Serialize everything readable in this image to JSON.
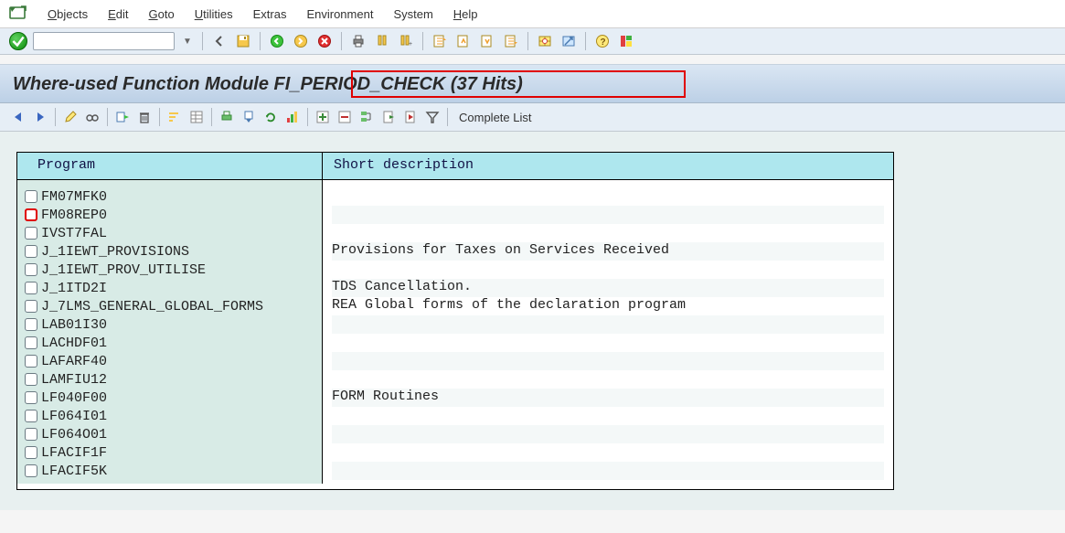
{
  "menu": {
    "items": [
      {
        "label": "Objects",
        "ul": "O"
      },
      {
        "label": "Edit",
        "ul": "E"
      },
      {
        "label": "Goto",
        "ul": "G"
      },
      {
        "label": "Utilities",
        "ul": "U"
      },
      {
        "label": "Extras",
        "ul": "E"
      },
      {
        "label": "Environment",
        "ul": "E"
      },
      {
        "label": "System",
        "ul": "S"
      },
      {
        "label": "Help",
        "ul": "H"
      }
    ]
  },
  "title": {
    "prefix": "Where-used Function Module ",
    "highlight": "FI_PERIOD_CHECK (37 Hits)"
  },
  "app_toolbar": {
    "complete_list": "Complete List"
  },
  "list": {
    "headers": {
      "program": "Program",
      "short_desc": "Short description"
    },
    "rows": [
      {
        "prog": "FM07MFK0",
        "desc": ""
      },
      {
        "prog": "FM08REP0",
        "desc": "",
        "red_cb": true
      },
      {
        "prog": "IVST7FAL",
        "desc": ""
      },
      {
        "prog": "J_1IEWT_PROVISIONS",
        "desc": "Provisions for Taxes on Services Received"
      },
      {
        "prog": "J_1IEWT_PROV_UTILISE",
        "desc": ""
      },
      {
        "prog": "J_1ITD2I",
        "desc": "TDS Cancellation."
      },
      {
        "prog": "J_7LMS_GENERAL_GLOBAL_FORMS",
        "desc": "REA Global forms of the declaration program"
      },
      {
        "prog": "LAB01I30",
        "desc": ""
      },
      {
        "prog": "LACHDF01",
        "desc": ""
      },
      {
        "prog": "LAFARF40",
        "desc": ""
      },
      {
        "prog": "LAMFIU12",
        "desc": ""
      },
      {
        "prog": "LF040F00",
        "desc": "FORM Routines"
      },
      {
        "prog": "LF064I01",
        "desc": ""
      },
      {
        "prog": "LF064O01",
        "desc": ""
      },
      {
        "prog": "LFACIF1F",
        "desc": ""
      },
      {
        "prog": "LFACIF5K",
        "desc": ""
      }
    ]
  },
  "icons": {
    "std": [
      "back",
      "save",
      "exit1",
      "exit2",
      "cancel",
      "print",
      "find",
      "findnext",
      "session1",
      "session2",
      "session3",
      "session4",
      "layout",
      "shortcut",
      "help",
      "color"
    ],
    "app": [
      "nav-back",
      "nav-fwd",
      "edit",
      "glasses",
      "assign",
      "delete",
      "group1",
      "group2",
      "export1",
      "export2",
      "export3",
      "export4",
      "expand",
      "collapse",
      "exec1",
      "exec2",
      "exec3",
      "filter"
    ]
  }
}
